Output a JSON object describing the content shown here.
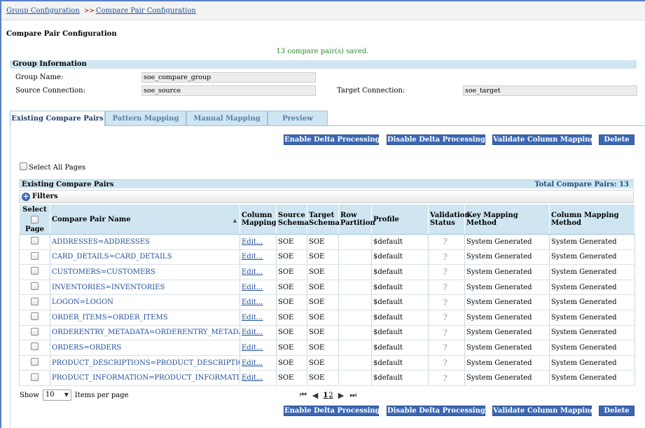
{
  "breadcrumb": {
    "items": [
      "Group Configuration",
      "Compare Pair Configuration"
    ],
    "separator": ">>"
  },
  "page_title": "Compare Pair Configuration",
  "status_message": "13 compare pair(s) saved.",
  "group_info": {
    "header": "Group Information",
    "group_name_label": "Group Name:",
    "group_name_value": "soe_compare_group",
    "source_conn_label": "Source Connection:",
    "source_conn_value": "soe_source",
    "target_conn_label": "Target Connection:",
    "target_conn_value": "soe_target"
  },
  "tabs": [
    {
      "label": "Existing Compare Pairs",
      "active": true
    },
    {
      "label": "Pattern Mapping",
      "active": false
    },
    {
      "label": "Manual Mapping",
      "active": false
    },
    {
      "label": "Preview",
      "active": false
    }
  ],
  "actions": {
    "enable_delta": "Enable Delta Processing",
    "disable_delta": "Disable Delta Processing",
    "validate_mapping": "Validate Column Mapping",
    "delete": "Delete"
  },
  "select_all_pages_label": "Select All Pages",
  "table": {
    "title": "Existing Compare Pairs",
    "total": "Total Compare Pairs: 13",
    "filters_label": "Filters",
    "headers": {
      "select_top": "Select",
      "select_bottom": "Page",
      "name": "Compare Pair Name",
      "column_mapping": "Column Mapping",
      "source_schema": "Source Schema",
      "target_schema": "Target Schema",
      "row_partition": "Row Partition",
      "profile": "Profile",
      "validation_status": "Validation Status",
      "key_mapping": "Key Mapping Method",
      "column_mapping_method": "Column Mapping Method"
    },
    "rows": [
      {
        "name": "ADDRESSES=ADDRESSES",
        "edit": "Edit...",
        "source": "SOE",
        "target": "SOE",
        "partition": "",
        "profile": "$default",
        "status": "?",
        "key_method": "System Generated",
        "col_method": "System Generated"
      },
      {
        "name": "CARD_DETAILS=CARD_DETAILS",
        "edit": "Edit...",
        "source": "SOE",
        "target": "SOE",
        "partition": "",
        "profile": "$default",
        "status": "?",
        "key_method": "System Generated",
        "col_method": "System Generated"
      },
      {
        "name": "CUSTOMERS=CUSTOMERS",
        "edit": "Edit...",
        "source": "SOE",
        "target": "SOE",
        "partition": "",
        "profile": "$default",
        "status": "?",
        "key_method": "System Generated",
        "col_method": "System Generated"
      },
      {
        "name": "INVENTORIES=INVENTORIES",
        "edit": "Edit...",
        "source": "SOE",
        "target": "SOE",
        "partition": "",
        "profile": "$default",
        "status": "?",
        "key_method": "System Generated",
        "col_method": "System Generated"
      },
      {
        "name": "LOGON=LOGON",
        "edit": "Edit...",
        "source": "SOE",
        "target": "SOE",
        "partition": "",
        "profile": "$default",
        "status": "?",
        "key_method": "System Generated",
        "col_method": "System Generated"
      },
      {
        "name": "ORDER_ITEMS=ORDER_ITEMS",
        "edit": "Edit...",
        "source": "SOE",
        "target": "SOE",
        "partition": "",
        "profile": "$default",
        "status": "?",
        "key_method": "System Generated",
        "col_method": "System Generated"
      },
      {
        "name": "ORDERENTRY_METADATA=ORDERENTRY_METADATA",
        "edit": "Edit...",
        "source": "SOE",
        "target": "SOE",
        "partition": "",
        "profile": "$default",
        "status": "?",
        "key_method": "System Generated",
        "col_method": "System Generated"
      },
      {
        "name": "ORDERS=ORDERS",
        "edit": "Edit...",
        "source": "SOE",
        "target": "SOE",
        "partition": "",
        "profile": "$default",
        "status": "?",
        "key_method": "System Generated",
        "col_method": "System Generated"
      },
      {
        "name": "PRODUCT_DESCRIPTIONS=PRODUCT_DESCRIPTIONS",
        "edit": "Edit...",
        "source": "SOE",
        "target": "SOE",
        "partition": "",
        "profile": "$default",
        "status": "?",
        "key_method": "System Generated",
        "col_method": "System Generated"
      },
      {
        "name": "PRODUCT_INFORMATION=PRODUCT_INFORMATION",
        "edit": "Edit...",
        "source": "SOE",
        "target": "SOE",
        "partition": "",
        "profile": "$default",
        "status": "?",
        "key_method": "System Generated",
        "col_method": "System Generated"
      }
    ]
  },
  "pagination": {
    "show_label": "Show",
    "per_page_value": "10",
    "items_per_page_label": "Items per page",
    "pages": [
      "1",
      "2"
    ],
    "current_page": "1"
  }
}
